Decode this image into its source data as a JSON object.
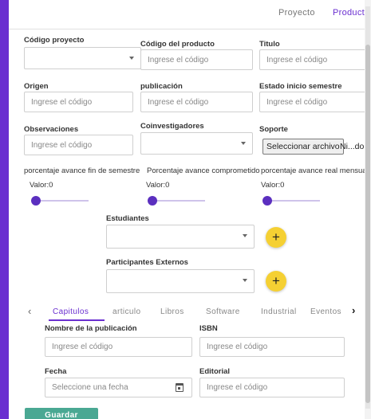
{
  "tabs": {
    "proyecto": "Proyecto",
    "producto": "Producto"
  },
  "labels": {
    "codigo_proyecto": "Código proyecto",
    "codigo_producto": "Código del producto",
    "titulo": "Titulo",
    "origen": "Origen",
    "publicacion": "publicación",
    "estado_inicio": "Estado inicio semestre",
    "observaciones": "Observaciones",
    "coinvestigadores": "Coinvestigadores",
    "soporte": "Soporte",
    "estudiantes": "Estudiantes",
    "participantes_externos": "Participantes Externos"
  },
  "placeholders": {
    "codigo": "Ingrese el código",
    "fecha": "Seleccione una fecha"
  },
  "file_input": {
    "button": "Seleccionar archivo",
    "name": "Ni...do"
  },
  "sliders": [
    {
      "label": "porcentaje avance fin de semestre",
      "value_text": "Valor:0",
      "value": 0
    },
    {
      "label": "Porcentaje avance comprometido",
      "value_text": "Valor:0",
      "value": 0
    },
    {
      "label": "porcentaje avance real mensual",
      "value_text": "Valor:0",
      "value": 0
    }
  ],
  "add_button": "+",
  "subtabs": [
    "Capitulos",
    "articulo",
    "Libros",
    "Software",
    "Industrial",
    "Eventos"
  ],
  "subtab_arrows": {
    "prev": "‹",
    "next": "›"
  },
  "capitulos": {
    "nombre_publicacion": "Nombre de la publicación",
    "isbn": "ISBN",
    "fecha": "Fecha",
    "editorial": "Editorial"
  },
  "save_button": "Guardar",
  "colors": {
    "accent": "#6a2fd0",
    "add_button": "#f5d033",
    "save_button": "#4aa893"
  }
}
